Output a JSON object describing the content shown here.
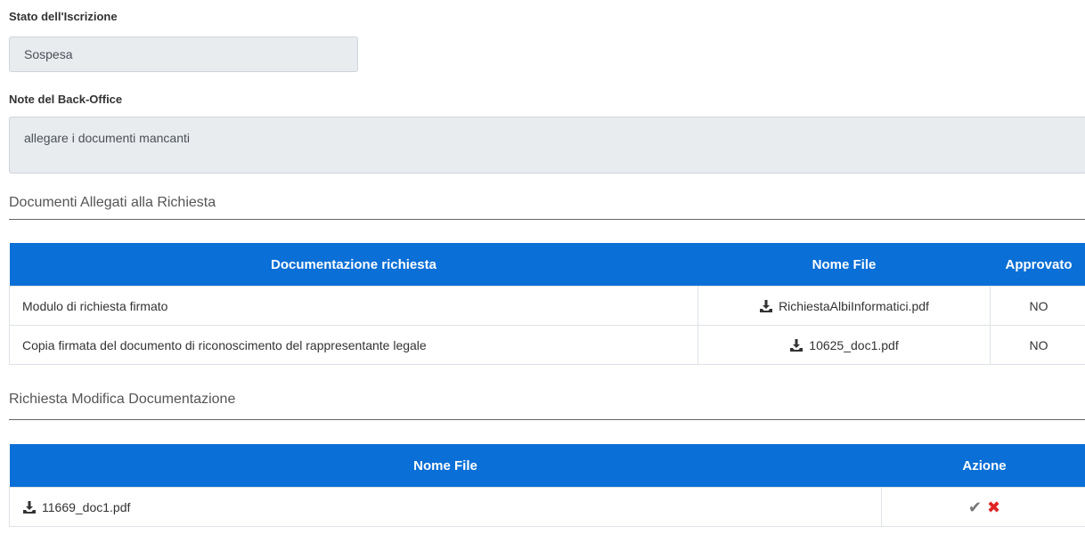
{
  "stato": {
    "label": "Stato dell'Iscrizione",
    "value": "Sospesa"
  },
  "note": {
    "label": "Note del Back-Office",
    "value": "allegare i documenti mancanti"
  },
  "documenti_allegati": {
    "title": "Documenti Allegati alla Richiesta",
    "columns": [
      "Documentazione richiesta",
      "Nome File",
      "Approvato"
    ],
    "rows": [
      {
        "doc": "Modulo di richiesta firmato",
        "file": "RichiestaAlbiInformatici.pdf",
        "approvato": "NO"
      },
      {
        "doc": "Copia firmata del documento di riconoscimento del rappresentante legale",
        "file": "10625_doc1.pdf",
        "approvato": "NO"
      }
    ]
  },
  "richiesta_modifica": {
    "title": "Richiesta Modifica Documentazione",
    "columns": [
      "Nome File",
      "Azione"
    ],
    "rows": [
      {
        "file": "11669_doc1.pdf",
        "actions": [
          "check-icon",
          "x-icon"
        ]
      }
    ]
  },
  "colors": {
    "header_blue": "#0a6fd6",
    "readonly_bg": "#e9ecef",
    "reject_red": "#e02424"
  }
}
